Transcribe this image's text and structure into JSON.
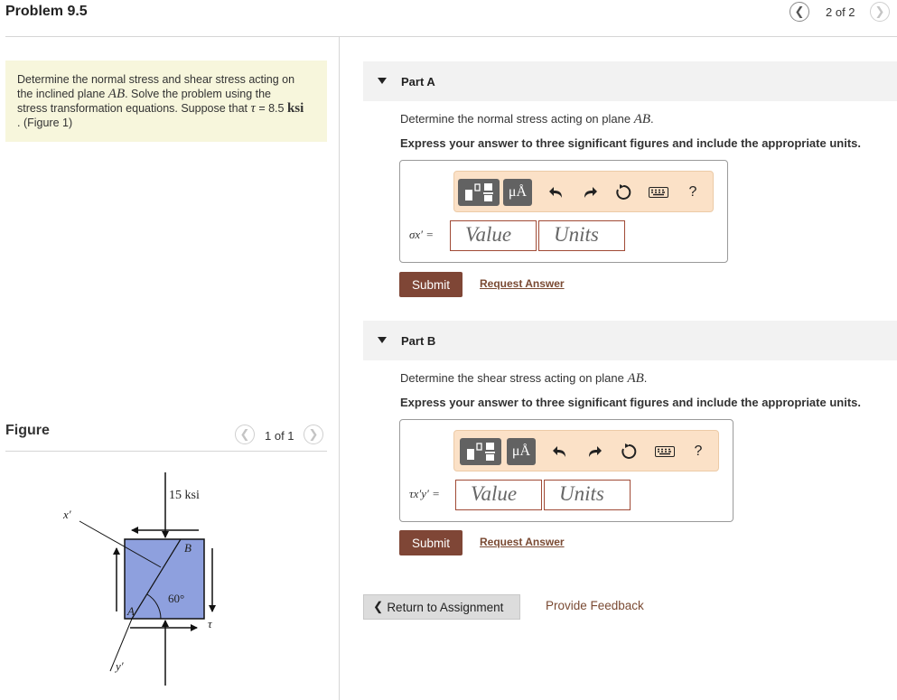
{
  "header": {
    "title": "Problem 9.5",
    "pager": "2 of 2"
  },
  "problem": {
    "line1": "Determine the normal stress and shear stress acting on",
    "line2_pre": "the inclined plane ",
    "plane": "AB",
    "line2_post": ". Solve the problem using the",
    "line3_pre": "stress transformation equations. Suppose that ",
    "tau": "τ",
    "line3_mid": " = 8.5 ",
    "unit": "ksi",
    "line4": ". ",
    "figure_link": "(Figure 1)"
  },
  "figure_panel": {
    "label": "Figure",
    "pager": "1 of 1",
    "diagram": {
      "stress_label": "15 ksi",
      "x_axis": "x′",
      "y_axis": "y′",
      "point_a": "A",
      "point_b": "B",
      "angle": "60°",
      "tau": "τ"
    }
  },
  "part_a": {
    "title": "Part A",
    "question_pre": "Determine the normal stress acting on plane ",
    "plane": "AB",
    "question_post": ".",
    "instruction": "Express your answer to three significant figures and include the appropriate units.",
    "var_label": "σx′ =",
    "value_placeholder": "Value",
    "units_placeholder": "Units",
    "submit": "Submit",
    "request": "Request Answer"
  },
  "part_b": {
    "title": "Part B",
    "question_pre": "Determine the shear stress acting on plane ",
    "plane": "AB",
    "question_post": ".",
    "instruction": "Express your answer to three significant figures and include the appropriate units.",
    "var_label": "τx′y′ =",
    "value_placeholder": "Value",
    "units_placeholder": "Units",
    "submit": "Submit",
    "request": "Request Answer"
  },
  "toolbar": {
    "units_symbol": "μÅ",
    "help": "?",
    "icons": [
      "templates-icon",
      "units-icon",
      "undo-icon",
      "redo-icon",
      "reset-icon",
      "keyboard-icon",
      "help-icon"
    ]
  },
  "footer": {
    "return": "Return to Assignment",
    "feedback": "Provide Feedback"
  },
  "colors": {
    "problem_bg": "#f7f6dc",
    "toolbar_bg": "#fbe1c7",
    "submit_bg": "#7f4636",
    "field_border": "#a04a35",
    "link": "#7a4a33",
    "block_fill": "#8ea0de"
  }
}
